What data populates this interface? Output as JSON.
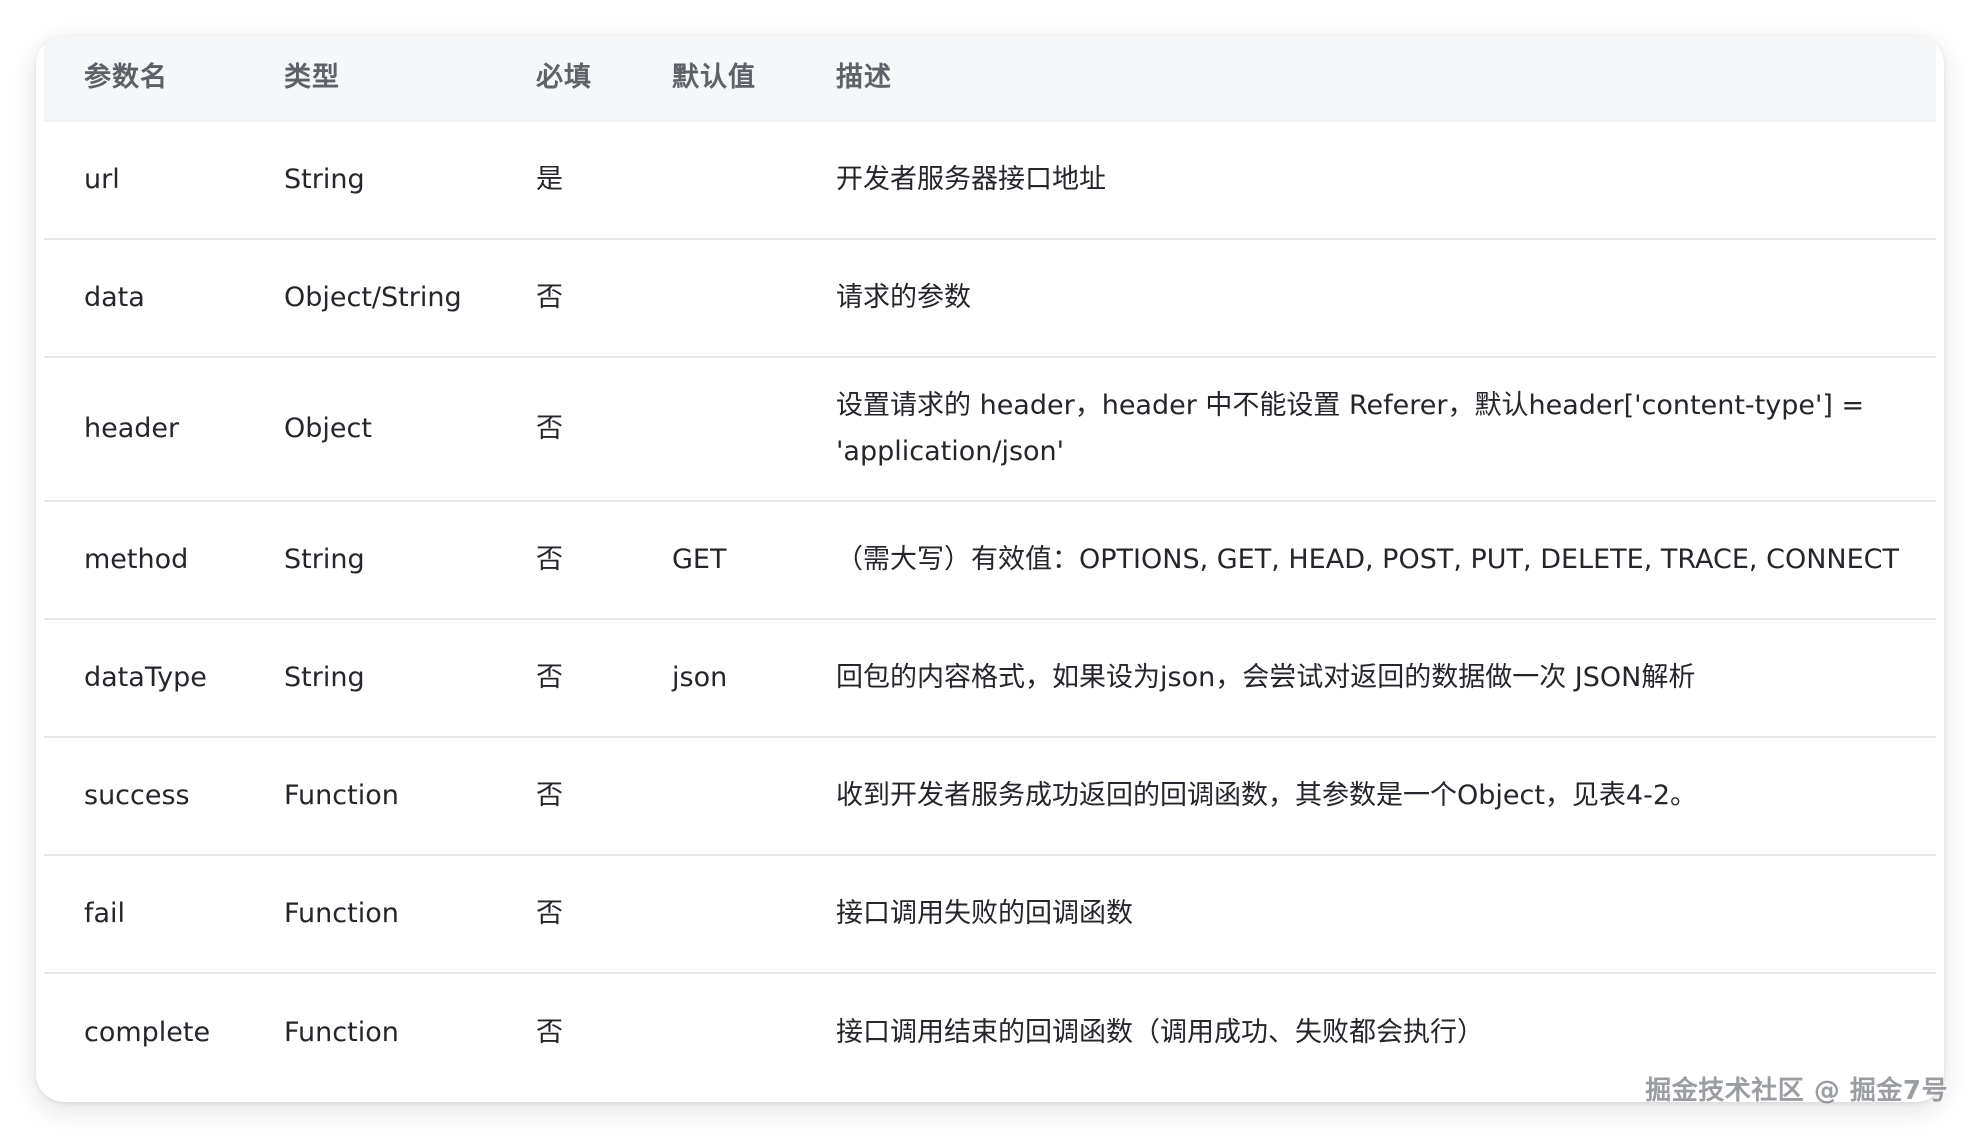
{
  "table": {
    "headers": [
      "参数名",
      "类型",
      "必填",
      "默认值",
      "描述"
    ],
    "rows": [
      [
        "url",
        "String",
        "是",
        "",
        "开发者服务器接口地址"
      ],
      [
        "data",
        "Object/String",
        "否",
        "",
        "请求的参数"
      ],
      [
        "header",
        "Object",
        "否",
        "",
        "设置请求的 header，header 中不能设置 Referer，默认header['content-type'] = 'application/json'"
      ],
      [
        "method",
        "String",
        "否",
        "GET",
        "（需大写）有效值：OPTIONS, GET, HEAD, POST, PUT, DELETE, TRACE, CONNECT"
      ],
      [
        "dataType",
        "String",
        "否",
        "json",
        "回包的内容格式，如果设为json，会尝试对返回的数据做一次 JSON解析"
      ],
      [
        "success",
        "Function",
        "否",
        "",
        "收到开发者服务成功返回的回调函数，其参数是一个Object，见表4-2。"
      ],
      [
        "fail",
        "Function",
        "否",
        "",
        "接口调用失败的回调函数"
      ],
      [
        "complete",
        "Function",
        "否",
        "",
        "接口调用结束的回调函数（调用成功、失败都会执行）"
      ]
    ]
  },
  "watermark": "掘金技术社区 @ 掘金7号"
}
